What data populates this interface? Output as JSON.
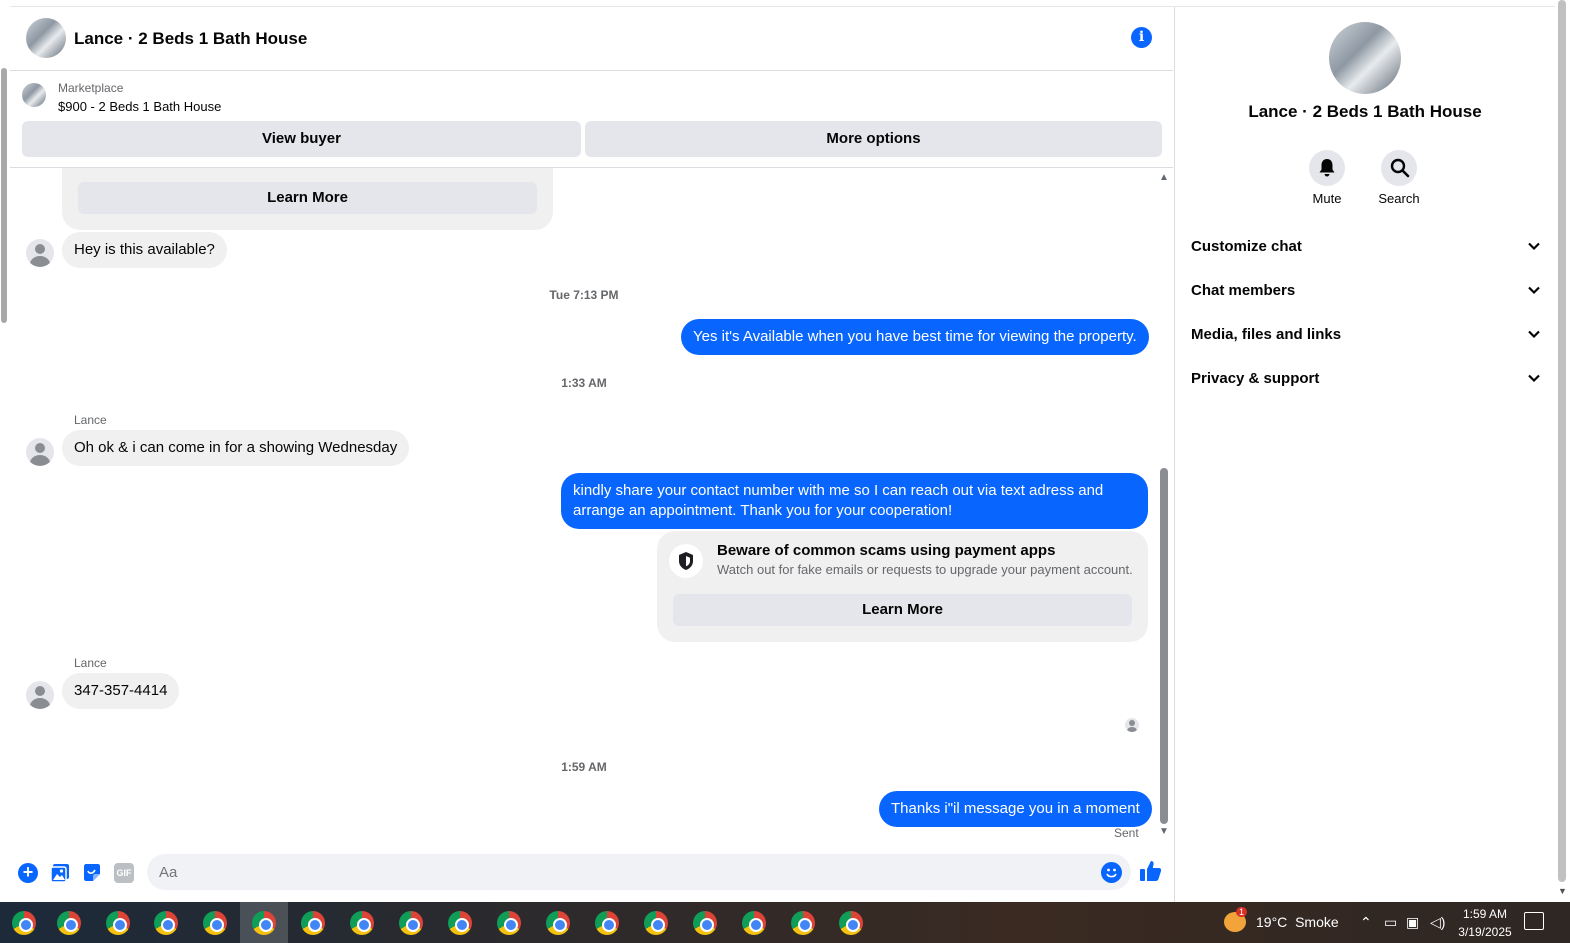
{
  "header": {
    "title": "Lance · 2 Beds 1 Bath House"
  },
  "marketplace": {
    "label": "Marketplace",
    "item": "$900 - 2 Beds 1 Bath House",
    "view_buyer": "View buyer",
    "more_options": "More options"
  },
  "messages": {
    "learn_more_top": "Learn More",
    "m1": "Hey is this available?",
    "t1": "Tue 7:13 PM",
    "m2": "Yes it's Available when you have best time for viewing the property.",
    "t2": "1:33 AM",
    "sender1": "Lance",
    "m3": "Oh ok & i can come in for a showing Wednesday",
    "m4": "kindly share your contact number with me so I can reach out via text adress and arrange an appointment. Thank you for your cooperation!",
    "scam_title": "Beware of common scams using payment apps",
    "scam_text": "Watch out for fake emails or requests to upgrade your payment account.",
    "learn_more_scam": "Learn More",
    "sender2": "Lance",
    "m5": "347-357-4414",
    "t3": "1:59 AM",
    "m6": "Thanks i\"il message you in a moment",
    "status": "Sent"
  },
  "composer": {
    "placeholder": "Aa",
    "gif": "GIF"
  },
  "right_panel": {
    "title": "Lance · 2 Beds 1 Bath House",
    "mute": "Mute",
    "search": "Search",
    "sections": [
      "Customize chat",
      "Chat members",
      "Media, files and links",
      "Privacy & support"
    ]
  },
  "taskbar": {
    "weather_badge": "1",
    "temp": "19°C",
    "condition": "Smoke",
    "time": "1:59 AM",
    "date": "3/19/2025"
  },
  "colors": {
    "accent": "#0866ff",
    "bubble_in": "#f0f0f0",
    "button_gray": "#e4e6eb"
  }
}
